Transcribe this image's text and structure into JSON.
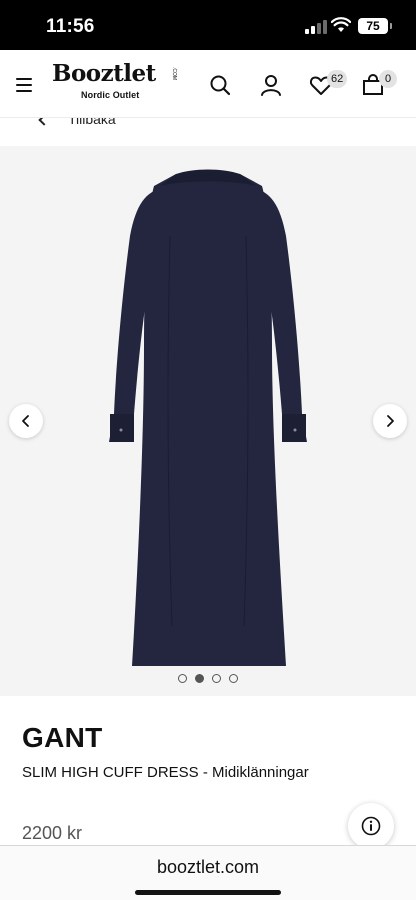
{
  "status_bar": {
    "time": "11:56",
    "battery": "75",
    "icons": [
      "signal-icon",
      "wifi-icon",
      "battery-icon"
    ]
  },
  "header": {
    "logo_text": "Booztlet",
    "logo_com": ".COM",
    "logo_subtitle": "Nordic Outlet",
    "icons": [
      "menu-icon",
      "search-icon",
      "user-icon",
      "heart-icon",
      "bag-icon"
    ],
    "wishlist_count": "62",
    "cart_count": "0"
  },
  "breadcrumb": {
    "text": "Tillbaka"
  },
  "gallery": {
    "image_count": 4,
    "active_index": 2,
    "prev_icon": "chevron-left-icon",
    "next_icon": "chevron-right-icon"
  },
  "product": {
    "brand": "GANT",
    "name": "SLIM HIGH CUFF DRESS - Midiklänningar",
    "price": "2200 kr"
  },
  "browser": {
    "url": "booztlet.com"
  },
  "colors": {
    "dress": "#23263e",
    "background": "#f4f4f4",
    "text": "#111111",
    "price": "#555555"
  }
}
